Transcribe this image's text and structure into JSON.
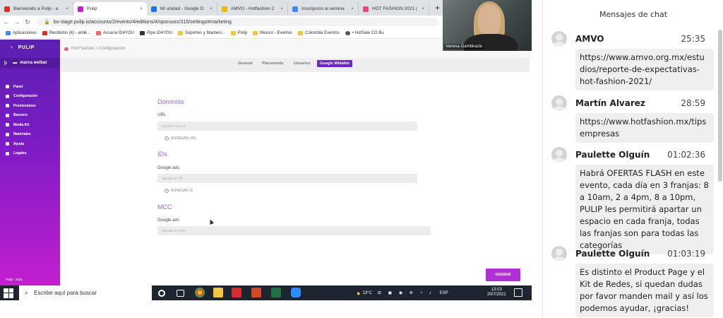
{
  "browser": {
    "tabs": [
      {
        "label": "Bienvenido a Pulip - a",
        "color": "#d93025"
      },
      {
        "label": "Pulip",
        "color": "#c21fcf"
      },
      {
        "label": "Mi unidad - Google D",
        "color": "#1a73e8"
      },
      {
        "label": "AMVO - Hotfashion 2",
        "color": "#f2b705"
      },
      {
        "label": "Inscripción al semina",
        "color": "#4285f4"
      },
      {
        "label": "HOT FASHION 2021 |",
        "color": "#e8467c"
      }
    ],
    "url": "bo-stage.pulip.io/accounts/2/events/4/editions/4/sponsors/315/settings#marketing",
    "bookmarks": [
      "Aplicaciones",
      "Recibidos (6) - amik...",
      "Assana ID4YOU",
      "Pipe ID4YOU",
      "Soportes y Manteni...",
      "Pulip",
      "Mexico - Eventos",
      "Colombia Eventos",
      "• HotSale CO Bu"
    ]
  },
  "webcam": {
    "name": "Vanesa Gambirazio"
  },
  "app": {
    "logo": "PULIP",
    "brand": "marca welbar",
    "menu": [
      "Panel",
      "Configuración",
      "Promociones",
      "Banners",
      "Media Kit",
      "Materiales",
      "Ayuda",
      "Legales"
    ],
    "footer": "Pulip - 2021",
    "breadcrumb": "Hot Fashion > Configuración",
    "subtabs": [
      "General",
      "Placements",
      "Usuarios",
      "Google Widaltst"
    ],
    "sections": {
      "domains": {
        "title": "Dominios",
        "label": "URL",
        "placeholder": "Ingrese una url",
        "add": "AGREGAR URL"
      },
      "ids": {
        "title": "IDs",
        "label": "Google ads",
        "placeholder": "Agrega un ID",
        "add": "AGREGAR ID"
      },
      "mcc": {
        "title": "MCC",
        "label": "Google ads",
        "placeholder": "Agrega un dato"
      }
    },
    "save": "GRABAR"
  },
  "taskbar": {
    "search": "Escribe aquí para buscar",
    "temp": "13°C",
    "lang": "ESP",
    "time": "13:03",
    "date": "20/7/2021"
  },
  "chat": {
    "title": "Mensajes de chat",
    "messages": [
      {
        "name": "AMVO",
        "time": "25:35",
        "text": "https://www.amvo.org.mx/estudios/reporte-de-expectativas-hot-fashion-2021/"
      },
      {
        "name": "Martín Alvarez",
        "time": "28:59",
        "text": "https://www.hotfashion.mx/tipsempresas"
      },
      {
        "name": "Paulette Olguín",
        "time": "01:02:36",
        "text": "Habrá OFERTAS FLASH en este evento, cada día en 3 franjas: 8 a 10am, 2 a 4pm, 8 a 10pm, PULIP les permitirá apartar un espacio en cada franja, todas las franjas son para todas las categorías"
      },
      {
        "name": "Paulette Olguín",
        "time": "01:03:19",
        "text": "Es distinto el Product Page y el Kit de Redes, si quedan dudas por favor manden mail y así los podemos ayudar, ¡gracias!"
      }
    ]
  }
}
